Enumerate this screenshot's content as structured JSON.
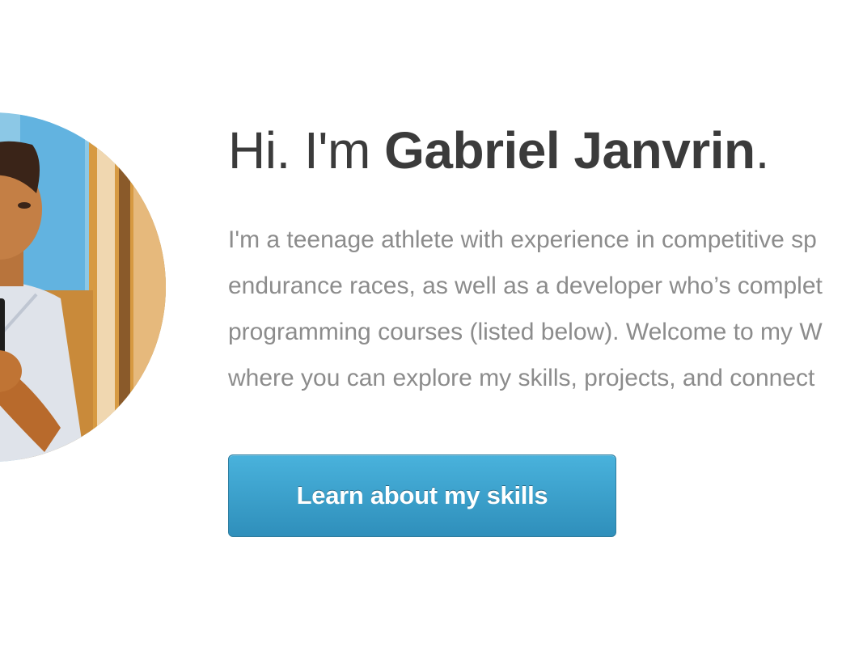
{
  "hero": {
    "greeting": "Hi. I'm ",
    "name": "Gabriel Janvrin",
    "period": ".",
    "intro_lines": [
      "I'm a teenage athlete with experience in competitive sp",
      "endurance races, as well as a developer who’s complet",
      "programming courses (listed below). Welcome to my W",
      "where you can explore my skills, projects, and connect"
    ],
    "cta_label": "Learn about my skills"
  },
  "colors": {
    "heading": "#3b3b3b",
    "body_text": "#8c8c8c",
    "button_top": "#49b2dc",
    "button_bottom": "#2f8fbb"
  },
  "icons": {
    "avatar": "profile-photo"
  }
}
